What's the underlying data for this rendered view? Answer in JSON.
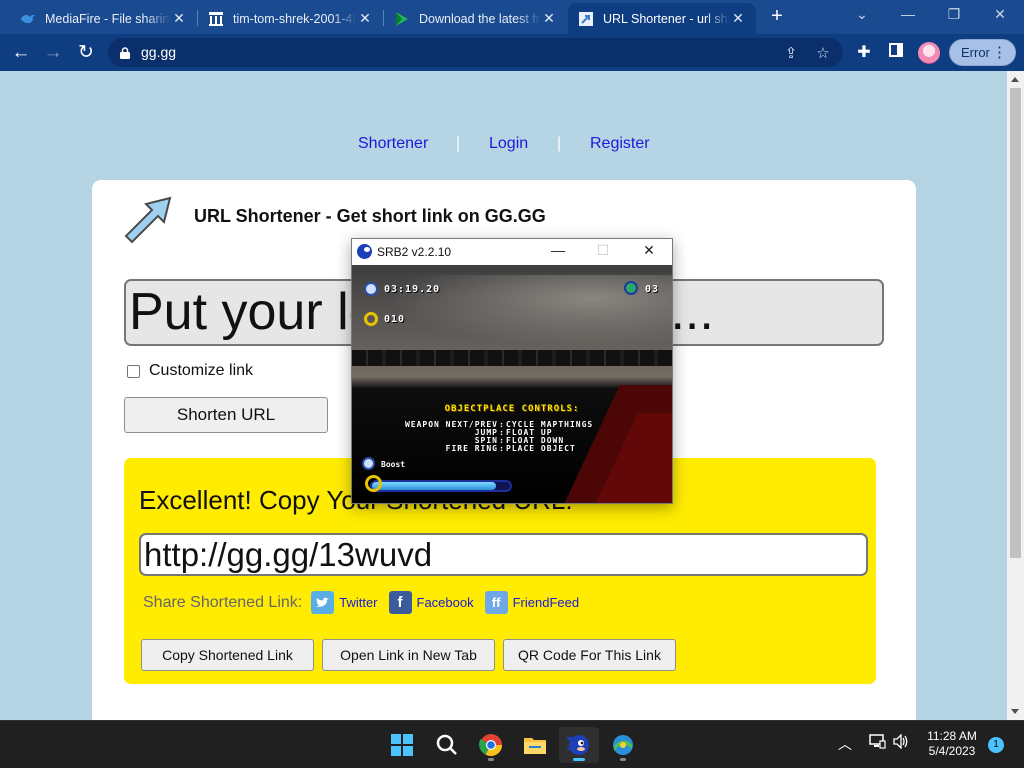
{
  "browser": {
    "tabs": [
      {
        "title": "MediaFire - File sharing",
        "favicon": "mediafire-icon"
      },
      {
        "title": "tim-tom-shrek-2001-4!",
        "favicon": "archive-icon"
      },
      {
        "title": "Download the latest fr",
        "favicon": "flag-icon"
      },
      {
        "title": "URL Shortener - url shr",
        "favicon": "gg-icon",
        "active": true
      }
    ],
    "address": "gg.gg",
    "profile_status": "Error",
    "accent": "#0f3d82"
  },
  "site": {
    "nav": [
      "Shortener",
      "Login",
      "Register"
    ],
    "nav_sep": "|",
    "title": "URL Shortener - Get short link on GG.GG",
    "long_url_placeholder": "Put your long URL here...",
    "customize_label": "Customize link",
    "shorten_button": "Shorten URL",
    "result": {
      "heading": "Excellent! Copy Your Shortened URL:",
      "short_url": "http://gg.gg/13wuvd",
      "share_label": "Share Shortened Link:",
      "share": [
        {
          "name": "Twitter",
          "icon": "twitter-icon",
          "color": "#5aaee8"
        },
        {
          "name": "Facebook",
          "icon": "facebook-icon",
          "color": "#3b5b9b"
        },
        {
          "name": "FriendFeed",
          "icon": "friendfeed-icon",
          "color": "#6fa8e6"
        }
      ],
      "buttons": [
        "Copy Shortened Link",
        "Open Link in New Tab",
        "QR Code For This Link"
      ],
      "background": "#ffec00"
    }
  },
  "game_window": {
    "title": "SRB2 v2.2.10",
    "hud": {
      "time": "03:19.20",
      "rings": "010",
      "lives": "03",
      "boost_label": "Boost",
      "boost_level": 0.9
    },
    "controls_heading": "OBJECTPLACE CONTROLS:",
    "controls": [
      {
        "key": "WEAPON NEXT/PREV",
        "action": "CYCLE MAPTHINGS"
      },
      {
        "key": "JUMP",
        "action": "FLOAT UP"
      },
      {
        "key": "SPIN",
        "action": "FLOAT DOWN"
      },
      {
        "key": "FIRE RING",
        "action": "PLACE OBJECT"
      }
    ]
  },
  "taskbar": {
    "apps": [
      "windows-start-icon",
      "search-icon",
      "chrome-icon",
      "file-explorer-icon",
      "srb2-icon",
      "network-app-icon"
    ],
    "time": "11:28 AM",
    "date": "5/4/2023",
    "notifications": "1"
  }
}
